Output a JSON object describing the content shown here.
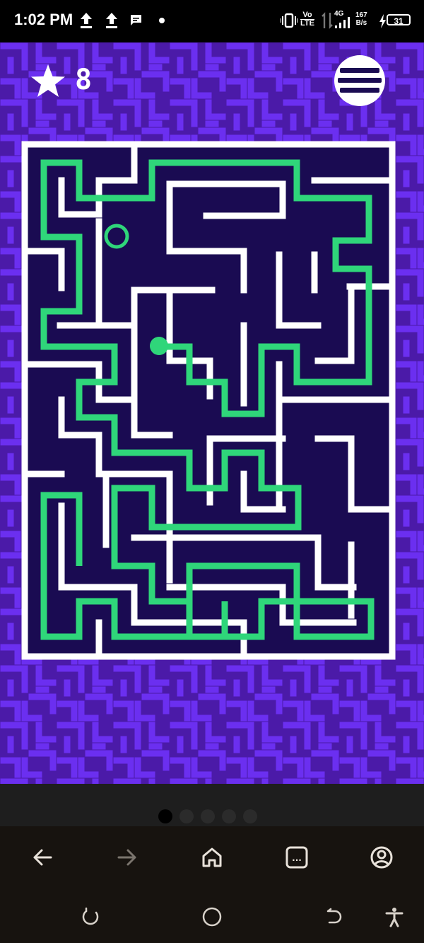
{
  "status_bar": {
    "time": "1:02 PM",
    "left_icons": [
      "upload-icon",
      "upload-icon",
      "message-icon",
      "dot-icon"
    ],
    "right_icons": [
      "vibrate-icon",
      "volte-icon",
      "data-arrows-icon",
      "signal-4g-icon",
      "battery-charging-icon"
    ],
    "volte_label_top": "Vo",
    "volte_label_bottom": "LTE",
    "network_type": "4G",
    "net_speed_value": "167",
    "net_speed_unit": "B/s",
    "battery_level": "31"
  },
  "game": {
    "score_icon": "star-icon",
    "score_value": "8",
    "menu_icon": "hamburger-menu-icon",
    "colors": {
      "background": "#4b1aa8",
      "maze_floor": "#1a0b52",
      "maze_walls": "#ffffff",
      "path": "#2fd67a",
      "player": "#2fd67a"
    }
  },
  "pagination": {
    "page_count": 5,
    "active_index": 0
  },
  "browser_nav": {
    "buttons": [
      "back-arrow-icon",
      "forward-arrow-icon",
      "home-icon",
      "tabs-icon",
      "account-icon"
    ],
    "tabs_label": "..."
  },
  "system_nav": {
    "buttons": [
      "recent-apps-icon",
      "home-circle-icon",
      "back-icon",
      "accessibility-icon"
    ]
  }
}
